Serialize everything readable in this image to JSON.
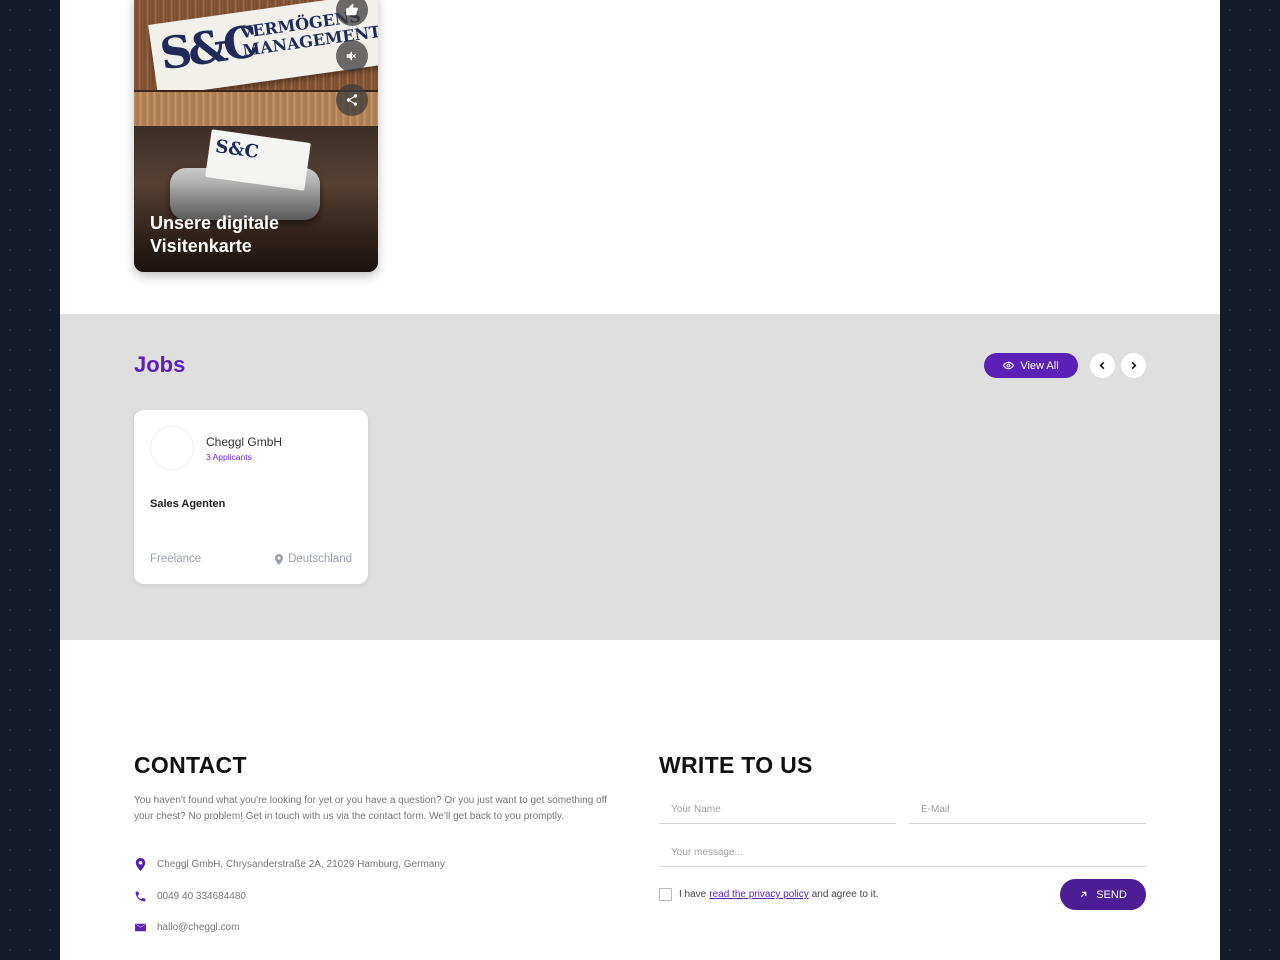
{
  "video": {
    "title": "Unsere digitale Visitenkarte",
    "banner_logo": "S&C",
    "banner_text_1": "VERMÖGENS",
    "banner_text_2": "MANAGEMENT",
    "controls": [
      "like-icon",
      "mute-icon",
      "share-icon"
    ]
  },
  "jobs": {
    "title": "Jobs",
    "view_all_label": "View All",
    "cards": [
      {
        "company": "Cheggl GmbH",
        "applicants": "3 Applicants",
        "title": "Sales Agenten",
        "type": "Freelance",
        "location": "Deutschland"
      }
    ]
  },
  "contact": {
    "title": "CONTACT",
    "text": "You haven't found what you're looking for yet or you have a question? Or you just want to get something off your chest? No problem! Get in touch with us via the contact form. We'll get back to you promptly.",
    "address": "Cheggl GmbH, Chrysanderstraße 2A, 21029 Hamburg, Germany",
    "phone": "0049 40 334684480",
    "email": "hallo@cheggl.com"
  },
  "form": {
    "title": "WRITE TO US",
    "name_placeholder": "Your Name",
    "email_placeholder": "E-Mail",
    "message_placeholder": "Your message...",
    "privacy_prefix": "I have",
    "privacy_link": "read the privacy policy",
    "privacy_suffix": "and agree to it.",
    "send_label": "SEND"
  },
  "colors": {
    "accent": "#5b21b6",
    "jobs_bg": "#dfdfdf",
    "outer_bg": "#131a2a"
  }
}
